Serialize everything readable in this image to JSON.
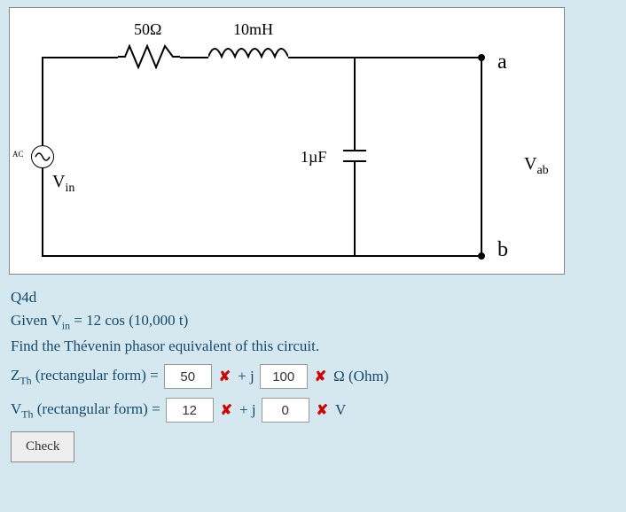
{
  "circuit": {
    "r_label": "50Ω",
    "l_label": "10mH",
    "c_label": "1µF",
    "vin": "V",
    "vin_sub": "in",
    "vab": "V",
    "vab_sub": "ab",
    "node_a": "a",
    "node_b": "b",
    "ac": "AC"
  },
  "question": {
    "id": "Q4d",
    "given_pre": "Given V",
    "given_sub": "in",
    "given_post": " = 12 cos (10,000 t)",
    "task": "Find the Thévenin phasor equivalent of this circuit.",
    "z_label_pre": "Z",
    "z_label_sub": "Th",
    "z_label_post": " (rectangular form) = ",
    "v_label_pre": "V",
    "v_label_sub": "Th",
    "v_label_post": " (rectangular form) = ",
    "plusj": "+ j",
    "z_unit": "Ω (Ohm)",
    "v_unit": "V",
    "z_real": "50",
    "z_imag": "100",
    "v_real": "12",
    "v_imag": "0",
    "check": "Check"
  }
}
